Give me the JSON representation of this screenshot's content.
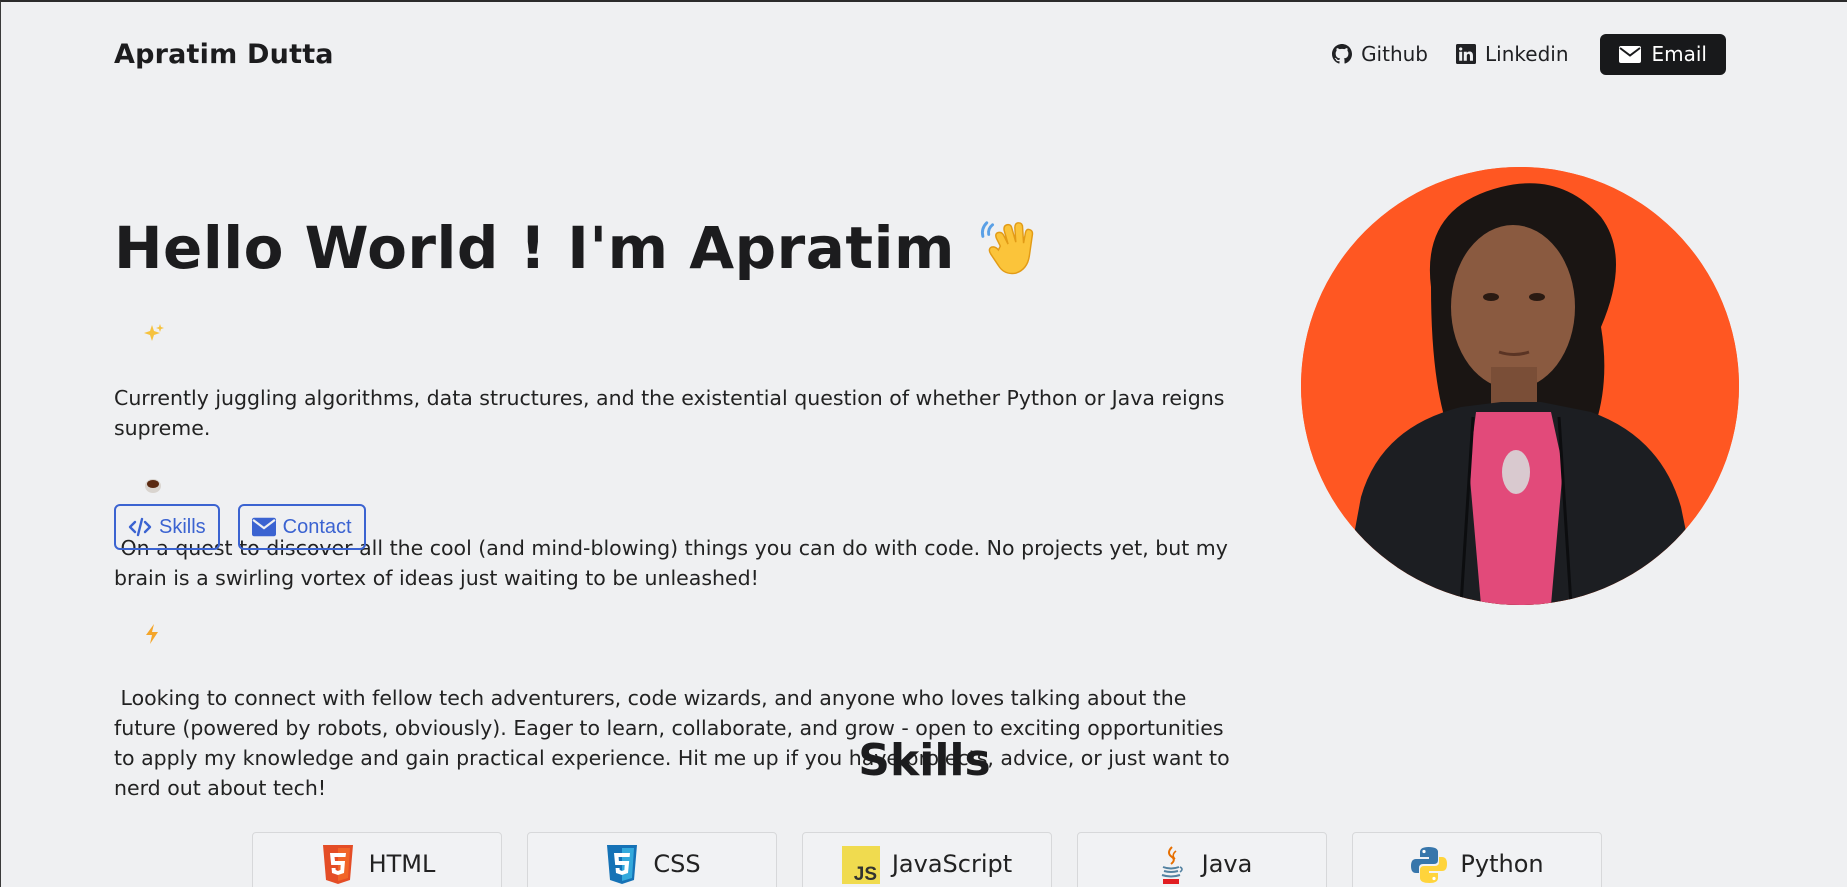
{
  "navbar": {
    "brand": "Apratim Dutta",
    "links": [
      {
        "label": "Github",
        "icon": "github-icon"
      },
      {
        "label": "Linkedin",
        "icon": "linkedin-icon"
      }
    ],
    "email_label": "Email"
  },
  "hero": {
    "title": "Hello World ! I'm Apratim",
    "title_emoji": "waving-hand-icon",
    "bio": {
      "part1": "Currently juggling algorithms, data structures, and the existential question of whether Python or Java reigns supreme. ",
      "part2": " On a quest to discover all the cool (and mind-blowing) things you can do with code. No projects yet, but my brain is a swirling vortex of ideas just waiting to be unleashed! ",
      "part3": " Looking to connect with fellow tech adventurers, code wizards, and anyone who loves talking about the future (powered by robots, obviously). Eager to learn, collaborate, and grow - open to exciting opportunities to apply my knowledge and gain practical experience. Hit me up if you have projects, advice, or just want to nerd out about tech!"
    },
    "buttons": {
      "skills": "Skills",
      "contact": "Contact"
    }
  },
  "skills": {
    "title": "Skills",
    "items": [
      {
        "label": "HTML",
        "icon": "html5-icon"
      },
      {
        "label": "CSS",
        "icon": "css3-icon"
      },
      {
        "label": "JavaScript",
        "icon": "javascript-icon"
      },
      {
        "label": "Java",
        "icon": "java-icon"
      },
      {
        "label": "Python",
        "icon": "python-icon"
      }
    ]
  },
  "colors": {
    "background": "#eff0f2",
    "accent": "#3b63d1",
    "avatar_bg": "#ff5722",
    "dark_button": "#18191b"
  }
}
